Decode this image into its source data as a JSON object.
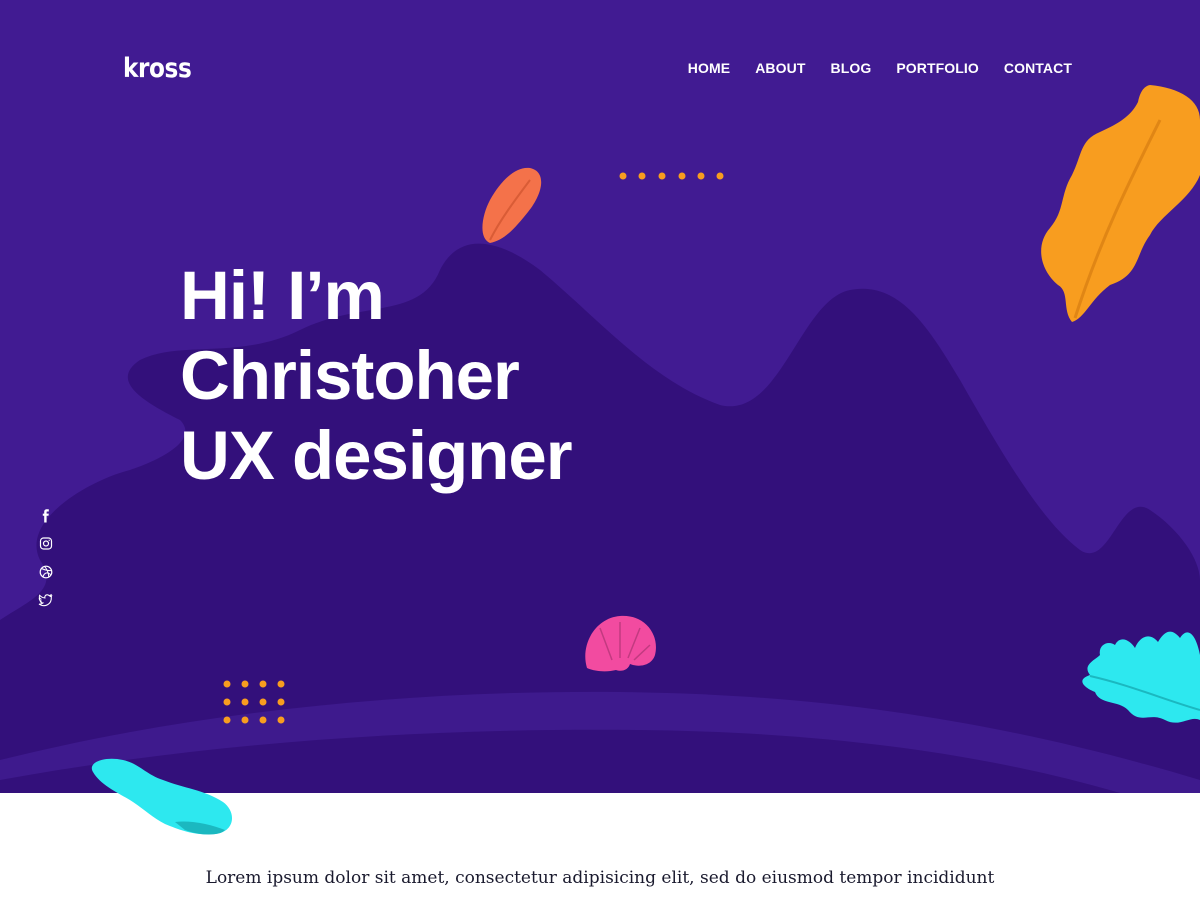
{
  "brand": {
    "logo": "kross"
  },
  "nav": {
    "items": [
      {
        "label": "HOME"
      },
      {
        "label": "ABOUT"
      },
      {
        "label": "BLOG"
      },
      {
        "label": "PORTFOLIO"
      },
      {
        "label": "CONTACT"
      }
    ]
  },
  "hero": {
    "headline_lines": [
      "Hi! I’m",
      "Christoher",
      "UX designer"
    ]
  },
  "social": {
    "items": [
      {
        "icon": "facebook-icon"
      },
      {
        "icon": "instagram-icon"
      },
      {
        "icon": "dribbble-icon"
      },
      {
        "icon": "twitter-icon"
      }
    ]
  },
  "intro": {
    "text": "Lorem ipsum dolor sit amet, consectetur adipisicing elit, sed do eiusmod tempor incididunt"
  },
  "colors": {
    "hero_background": "#411b92",
    "hero_dark_shape": "#33107b",
    "accent_orange": "#f89d1f",
    "accent_coral": "#f4724a",
    "accent_pink": "#f24ba0",
    "accent_cyan": "#2de8ef",
    "text_white": "#ffffff"
  }
}
